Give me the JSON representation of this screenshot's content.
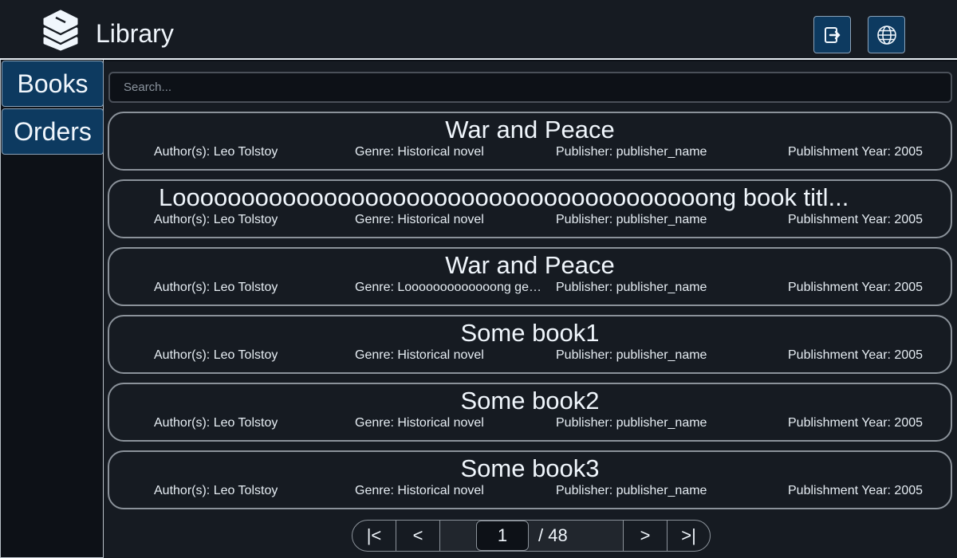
{
  "header": {
    "title": "Library",
    "logo_icon": "books-stack-icon",
    "logout_icon": "logout-icon",
    "language_icon": "globe-icon",
    "accent_color": "#0d3a60"
  },
  "sidebar": {
    "items": [
      {
        "label": "Books"
      },
      {
        "label": "Orders"
      }
    ]
  },
  "search": {
    "placeholder": "Search...",
    "value": ""
  },
  "books": [
    {
      "title": "War and Peace",
      "author": "Author(s): Leo Tolstoy",
      "genre": "Genre: Historical novel",
      "publisher": "Publisher: publisher_name",
      "year": "Publishment Year: 2005"
    },
    {
      "title": "Looooooooooooooooooooooooooooooooooooooong book titl...",
      "author": "Author(s): Leo Tolstoy",
      "genre": "Genre: Historical novel",
      "publisher": "Publisher: publisher_name",
      "year": "Publishment Year: 2005"
    },
    {
      "title": "War and Peace",
      "author": "Author(s): Leo Tolstoy",
      "genre": "Genre: Looooooooooooong gen...",
      "publisher": "Publisher: publisher_name",
      "year": "Publishment Year: 2005"
    },
    {
      "title": "Some book1",
      "author": "Author(s): Leo Tolstoy",
      "genre": "Genre: Historical novel",
      "publisher": "Publisher: publisher_name",
      "year": "Publishment Year: 2005"
    },
    {
      "title": "Some book2",
      "author": "Author(s): Leo Tolstoy",
      "genre": "Genre: Historical novel",
      "publisher": "Publisher: publisher_name",
      "year": "Publishment Year: 2005"
    },
    {
      "title": "Some book3",
      "author": "Author(s): Leo Tolstoy",
      "genre": "Genre: Historical novel",
      "publisher": "Publisher: publisher_name",
      "year": "Publishment Year: 2005"
    }
  ],
  "pagination": {
    "first_label": "|<",
    "prev_label": "<",
    "current_page": "1",
    "total_label": "/ 48",
    "next_label": ">",
    "last_label": ">|"
  }
}
